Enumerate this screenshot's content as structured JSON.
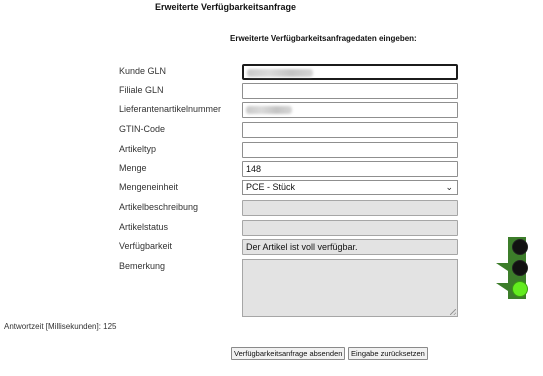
{
  "page": {
    "title": "Erweiterte Verfügbarkeitsanfrage",
    "section_title": "Erweiterte Verfügbarkeitsanfragedaten eingeben:"
  },
  "form": {
    "kunde_gln": {
      "label": "Kunde GLN",
      "value": "4012345000009"
    },
    "filiale_gln": {
      "label": "Filiale GLN",
      "value": ""
    },
    "lieferantenartikelnummer": {
      "label": "Lieferantenartikelnummer",
      "value": "1831503.04"
    },
    "gtin_code": {
      "label": "GTIN-Code",
      "value": ""
    },
    "artikeltyp": {
      "label": "Artikeltyp",
      "value": ""
    },
    "menge": {
      "label": "Menge",
      "value": "148"
    },
    "mengeneinheit": {
      "label": "Mengeneinheit",
      "selected": "PCE - Stück"
    },
    "artikelbeschreibung": {
      "label": "Artikelbeschreibung",
      "value": ""
    },
    "artikelstatus": {
      "label": "Artikelstatus",
      "value": ""
    },
    "verfuegbarkeit": {
      "label": "Verfügbarkeit",
      "value": "Der Artikel ist voll verfügbar."
    },
    "bemerkung": {
      "label": "Bemerkung",
      "value": ""
    }
  },
  "response_time": "Antwortzeit [Millisekunden]: 125",
  "buttons": {
    "submit": "Verfügbarkeitsanfrage absenden",
    "reset": "Eingabe zurücksetzen"
  },
  "traffic_light": {
    "active": "green",
    "housing_color": "#3c7d2a",
    "off_color": "#111111",
    "green_color": "#63ec1f"
  }
}
